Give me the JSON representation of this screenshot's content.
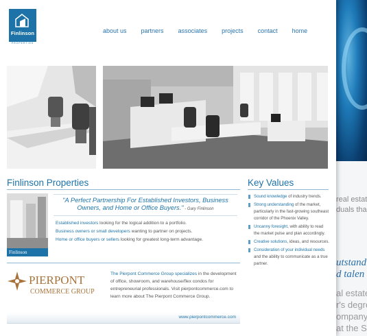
{
  "colors": {
    "brand": "#1d73a8",
    "accent_bg": "#0b3f70",
    "pierpont_gold": "#a8733a"
  },
  "logo": {
    "name": "Finlinson",
    "subtitle": "PROPERTIES"
  },
  "nav": {
    "items": [
      "about us",
      "partners",
      "associates",
      "projects",
      "contact",
      "home"
    ]
  },
  "main": {
    "title": "Finlinson Properties",
    "quote": "\"A Perfect Partnership For Established Investors, Business Owners, and Home or Office Buyers.\"",
    "quote_by": " - Gary Finlinson",
    "thumb_label": "Finlinson",
    "lines": [
      {
        "hl": "Established investors",
        "rest": " looking for the logical addition to a portfolio."
      },
      {
        "hl": "Business owners or small developers",
        "rest": " wanting to partner on projects."
      },
      {
        "hl": "Home or office buyers or sellers",
        "rest": " looking for greatest long-term advantage."
      }
    ]
  },
  "values": {
    "title": "Key Values",
    "items": [
      {
        "hl": "Sound knowledge",
        "rest": " of industry trends."
      },
      {
        "hl": "Strong understanding",
        "rest": " of the market, particularly in the fast-growing southeast corridor of the Phoenix Valley."
      },
      {
        "hl": "Uncanny foresight",
        "rest": ", with ability to read the market pulse and plan accordingly."
      },
      {
        "hl": "Creative solutions",
        "rest": ", ideas, and resources."
      },
      {
        "hl": "Consideration of your individual needs",
        "rest": " and the ability to communicate as a true partner."
      }
    ]
  },
  "pierpont": {
    "logo_word1": "PIERPONT",
    "logo_word2": "COMMERCE GROUP",
    "hl": "The Pierpont Commerce Group specializes",
    "rest": " in the development of office, showroom, and warehouse/flex condos for entrepreneurial professionals. Visit pierpontcommerce.com to learn more about The Pierpont Commerce Group.",
    "url": "www.pierpontcommerce.com"
  },
  "background_page": {
    "snippets": [
      "real estat",
      "duals tha",
      "utstand",
      "d talen",
      "al estate",
      "r's degre",
      "ompany a",
      "at the Sa"
    ]
  }
}
